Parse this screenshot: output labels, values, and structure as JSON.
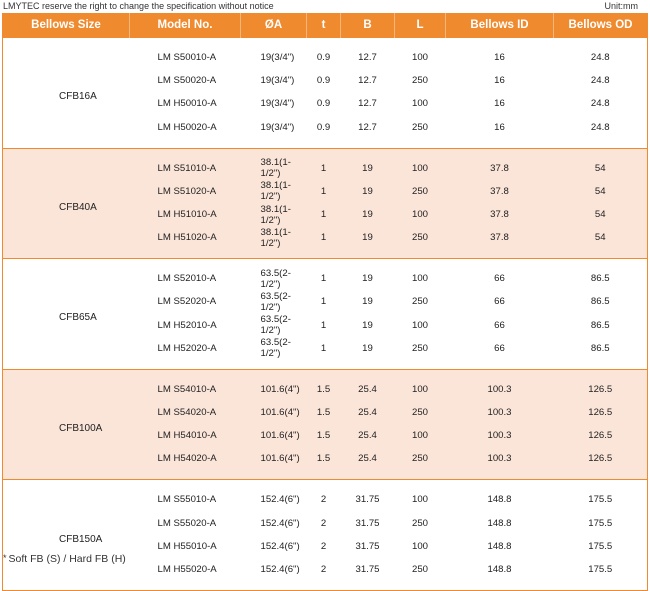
{
  "header_notice": "LMYTEC reserve the right to change the specification without notice",
  "unit": "Unit:mm",
  "columns": [
    "Bellows Size",
    "Model No.",
    "ØA",
    "t",
    "B",
    "L",
    "Bellows ID",
    "Bellows OD"
  ],
  "groups": [
    {
      "size": "CFB16A",
      "rows": [
        [
          "LM S50010-A",
          "19(3/4\")",
          "0.9",
          "12.7",
          "100",
          "16",
          "24.8"
        ],
        [
          "LM S50020-A",
          "19(3/4\")",
          "0.9",
          "12.7",
          "250",
          "16",
          "24.8"
        ],
        [
          "LM H50010-A",
          "19(3/4\")",
          "0.9",
          "12.7",
          "100",
          "16",
          "24.8"
        ],
        [
          "LM H50020-A",
          "19(3/4\")",
          "0.9",
          "12.7",
          "250",
          "16",
          "24.8"
        ]
      ]
    },
    {
      "size": "CFB40A",
      "rows": [
        [
          "LM S51010-A",
          "38.1(1-1/2\")",
          "1",
          "19",
          "100",
          "37.8",
          "54"
        ],
        [
          "LM S51020-A",
          "38.1(1-1/2\")",
          "1",
          "19",
          "250",
          "37.8",
          "54"
        ],
        [
          "LM H51010-A",
          "38.1(1-1/2\")",
          "1",
          "19",
          "100",
          "37.8",
          "54"
        ],
        [
          "LM H51020-A",
          "38.1(1-1/2\")",
          "1",
          "19",
          "250",
          "37.8",
          "54"
        ]
      ]
    },
    {
      "size": "CFB65A",
      "rows": [
        [
          "LM S52010-A",
          "63.5(2-1/2\")",
          "1",
          "19",
          "100",
          "66",
          "86.5"
        ],
        [
          "LM S52020-A",
          "63.5(2-1/2\")",
          "1",
          "19",
          "250",
          "66",
          "86.5"
        ],
        [
          "LM H52010-A",
          "63.5(2-1/2\")",
          "1",
          "19",
          "100",
          "66",
          "86.5"
        ],
        [
          "LM H52020-A",
          "63.5(2-1/2\")",
          "1",
          "19",
          "250",
          "66",
          "86.5"
        ]
      ]
    },
    {
      "size": "CFB100A",
      "rows": [
        [
          "LM S54010-A",
          "101.6(4\")",
          "1.5",
          "25.4",
          "100",
          "100.3",
          "126.5"
        ],
        [
          "LM S54020-A",
          "101.6(4\")",
          "1.5",
          "25.4",
          "250",
          "100.3",
          "126.5"
        ],
        [
          "LM H54010-A",
          "101.6(4\")",
          "1.5",
          "25.4",
          "100",
          "100.3",
          "126.5"
        ],
        [
          "LM H54020-A",
          "101.6(4\")",
          "1.5",
          "25.4",
          "250",
          "100.3",
          "126.5"
        ]
      ]
    },
    {
      "size": "CFB150A",
      "rows": [
        [
          "LM S55010-A",
          "152.4(6\")",
          "2",
          "31.75",
          "100",
          "148.8",
          "175.5"
        ],
        [
          "LM S55020-A",
          "152.4(6\")",
          "2",
          "31.75",
          "250",
          "148.8",
          "175.5"
        ],
        [
          "LM H55010-A",
          "152.4(6\")",
          "2",
          "31.75",
          "100",
          "148.8",
          "175.5"
        ],
        [
          "LM H55020-A",
          "152.4(6\")",
          "2",
          "31.75",
          "250",
          "148.8",
          "175.5"
        ]
      ]
    }
  ],
  "footnote_marker": "*",
  "footnote": "Soft FB (S) / Hard FB (H)",
  "colors": {
    "header": "#ef8a2e",
    "shade": "#fbe5d9",
    "border": "#ef8a2e"
  }
}
